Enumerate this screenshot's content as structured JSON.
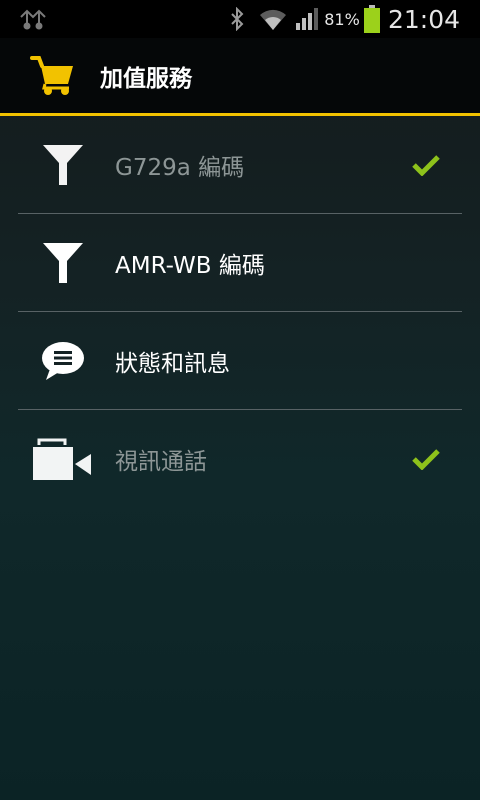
{
  "status_bar": {
    "battery_percent": "81%",
    "time": "21:04",
    "icons": [
      "usb-icon",
      "bluetooth-icon",
      "wifi-icon",
      "signal-icon",
      "battery-icon"
    ]
  },
  "action_bar": {
    "icon": "shopping-cart-icon",
    "title": "加值服務",
    "accent_color": "#f2c200"
  },
  "list": {
    "items": [
      {
        "label": "G729a 編碼",
        "icon": "filter-icon",
        "checked": true,
        "enabled": false
      },
      {
        "label": "AMR-WB 編碼",
        "icon": "filter-icon",
        "checked": false,
        "enabled": true
      },
      {
        "label": "狀態和訊息",
        "icon": "chat-bubble-icon",
        "checked": false,
        "enabled": true
      },
      {
        "label": "視訊通話",
        "icon": "video-camera-icon",
        "checked": true,
        "enabled": false
      }
    ],
    "check_color": "#8ec21b"
  }
}
